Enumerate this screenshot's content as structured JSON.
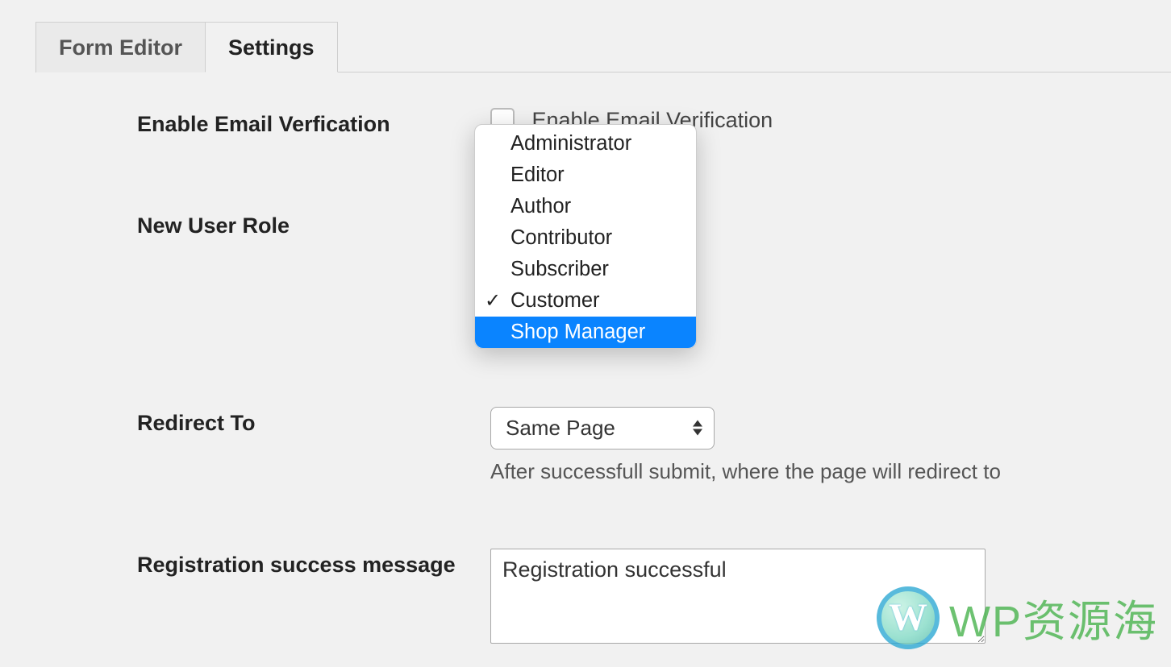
{
  "tabs": {
    "form_editor": "Form Editor",
    "settings": "Settings",
    "active": "settings"
  },
  "fields": {
    "email_verification": {
      "label": "Enable Email Verfication",
      "checkbox_label": "Enable Email Verification",
      "checked": false
    },
    "new_user_role": {
      "label": "New User Role",
      "options": [
        "Administrator",
        "Editor",
        "Author",
        "Contributor",
        "Subscriber",
        "Customer",
        "Shop Manager"
      ],
      "selected": "Customer",
      "highlighted": "Shop Manager"
    },
    "redirect_to": {
      "label": "Redirect To",
      "value": "Same Page",
      "help": "After successfull submit, where the page will redirect to"
    },
    "registration_message": {
      "label": "Registration success message",
      "value": "Registration successful"
    }
  },
  "watermark": {
    "logo_letter": "W",
    "text": "WP资源海"
  }
}
